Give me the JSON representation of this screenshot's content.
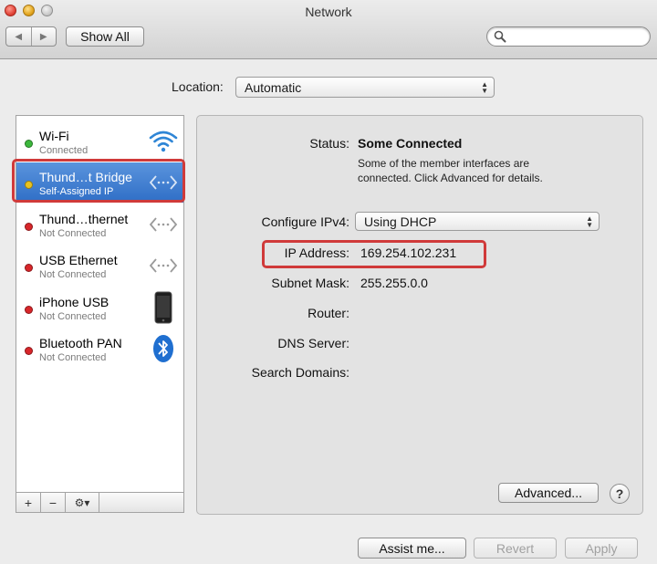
{
  "window": {
    "title": "Network"
  },
  "toolbar": {
    "back_icon": "back-arrow-icon",
    "forward_icon": "forward-arrow-icon",
    "show_all_label": "Show All",
    "search_value": "",
    "search_icon": "magnifier-icon"
  },
  "location": {
    "label": "Location:",
    "value": "Automatic"
  },
  "sidebar": {
    "services": [
      {
        "name": "Wi-Fi",
        "status": "Connected",
        "status_color": "#3cb83c",
        "icon": "wifi-icon",
        "selected": false
      },
      {
        "name": "Thund…t Bridge",
        "status": "Self-Assigned IP",
        "status_color": "#e8c21f",
        "icon": "ethernet-arrows-icon",
        "selected": true
      },
      {
        "name": "Thund…thernet",
        "status": "Not Connected",
        "status_color": "#d8262a",
        "icon": "ethernet-arrows-icon",
        "selected": false
      },
      {
        "name": "USB Ethernet",
        "status": "Not Connected",
        "status_color": "#d8262a",
        "icon": "ethernet-arrows-icon",
        "selected": false
      },
      {
        "name": "iPhone USB",
        "status": "Not Connected",
        "status_color": "#d8262a",
        "icon": "iphone-icon",
        "selected": false
      },
      {
        "name": "Bluetooth PAN",
        "status": "Not Connected",
        "status_color": "#d8262a",
        "icon": "bluetooth-icon",
        "selected": false
      }
    ],
    "add_label": "+",
    "remove_label": "−",
    "action_label": "⚙▾"
  },
  "detail": {
    "status_label": "Status:",
    "status_value": "Some Connected",
    "status_note": "Some of the member interfaces are connected. Click Advanced for details.",
    "configure_label": "Configure IPv4:",
    "configure_value": "Using DHCP",
    "ip_label": "IP Address:",
    "ip_value": "169.254.102.231",
    "subnet_label": "Subnet Mask:",
    "subnet_value": "255.255.0.0",
    "router_label": "Router:",
    "router_value": "",
    "dns_label": "DNS Server:",
    "dns_value": "",
    "search_domains_label": "Search Domains:",
    "search_domains_value": "",
    "advanced_label": "Advanced...",
    "help_label": "?"
  },
  "footer": {
    "assist_label": "Assist me...",
    "revert_label": "Revert",
    "apply_label": "Apply"
  },
  "annotations": {
    "highlight_color": "#d03a3a"
  }
}
